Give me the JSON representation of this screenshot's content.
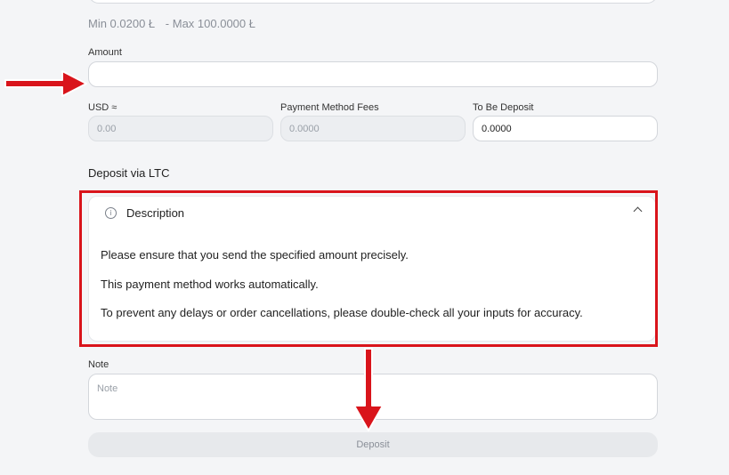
{
  "limits": {
    "min": "Min 0.0200 Ł",
    "max": "- Max 100.0000 Ł"
  },
  "amount": {
    "label": "Amount",
    "value": "",
    "placeholder": ""
  },
  "usd": {
    "label": "USD ≈",
    "value": "0.00"
  },
  "fees": {
    "label": "Payment Method Fees",
    "value": "0.0000"
  },
  "to_deposit": {
    "label": "To Be Deposit",
    "value": "0.0000"
  },
  "deposit_via": "Deposit via LTC",
  "description": {
    "title": "Description",
    "lines": [
      "Please ensure that you send the specified amount precisely.",
      "This payment method works automatically.",
      "To prevent any delays or order cancellations, please double-check all your inputs for accuracy."
    ]
  },
  "note": {
    "label": "Note",
    "placeholder": "Note"
  },
  "deposit_button": "Deposit",
  "colors": {
    "annotation_red": "#d9141b",
    "page_bg": "#f4f5f7",
    "disabled_bg": "#eceef1"
  },
  "icons": [
    "info-icon",
    "chevron-up-icon",
    "arrow-right-icon",
    "arrow-down-icon"
  ]
}
